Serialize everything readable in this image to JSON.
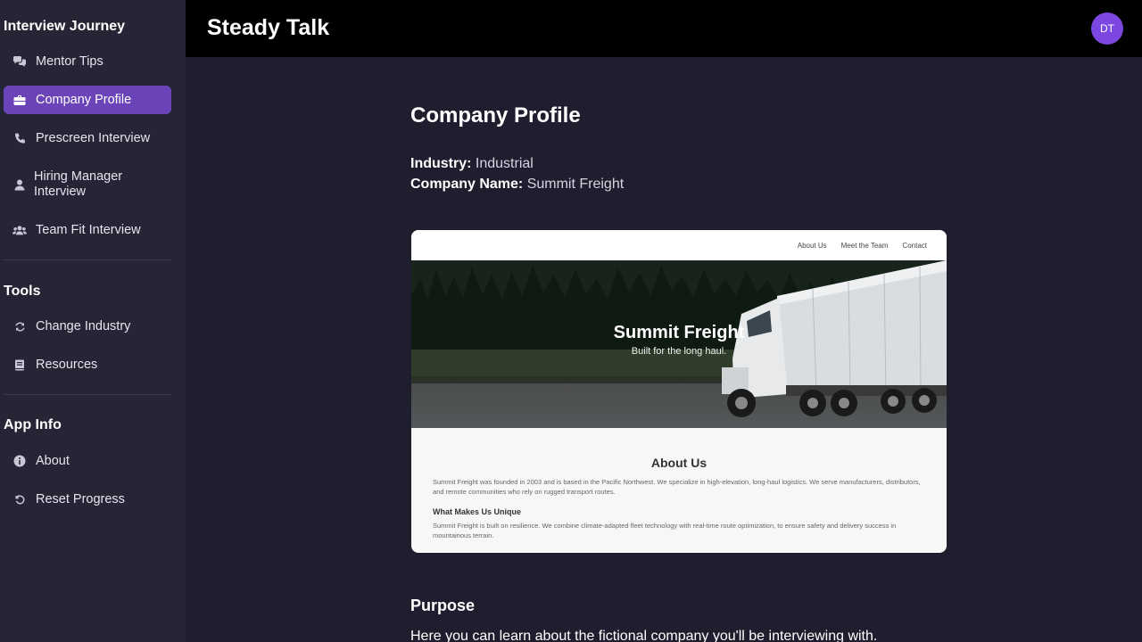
{
  "sidebar": {
    "journey_title": "Interview Journey",
    "journey_items": [
      {
        "label": "Mentor Tips",
        "icon": "comments-icon"
      },
      {
        "label": "Company Profile",
        "icon": "briefcase-icon"
      },
      {
        "label": "Prescreen Interview",
        "icon": "phone-icon"
      },
      {
        "label": "Hiring Manager Interview",
        "icon": "user-icon"
      },
      {
        "label": "Team Fit Interview",
        "icon": "users-icon"
      }
    ],
    "tools_title": "Tools",
    "tools_items": [
      {
        "label": "Change Industry",
        "icon": "sync-icon"
      },
      {
        "label": "Resources",
        "icon": "book-icon"
      }
    ],
    "info_title": "App Info",
    "info_items": [
      {
        "label": "About",
        "icon": "info-icon"
      },
      {
        "label": "Reset Progress",
        "icon": "reset-icon"
      }
    ]
  },
  "header": {
    "brand": "Steady Talk",
    "avatar_initials": "DT"
  },
  "main": {
    "title": "Company Profile",
    "industry_label": "Industry:",
    "industry_value": "Industrial",
    "company_label": "Company Name:",
    "company_value": "Summit Freight",
    "purpose_title": "Purpose",
    "purpose_text": "Here you can learn about the fictional company you'll be interviewing with."
  },
  "preview": {
    "nav": [
      "About Us",
      "Meet the Team",
      "Contact"
    ],
    "hero_title": "Summit Freight",
    "hero_subtitle": "Built for the long haul.",
    "about_title": "About Us",
    "about_text": "Summit Freight was founded in 2003 and is based in the Pacific Northwest. We specialize in high-elevation, long-haul logistics. We serve manufacturers, distributors, and remote communities who rely on rugged transport routes.",
    "unique_title": "What Makes Us Unique",
    "unique_text": "Summit Freight is built on resilience. We combine climate-adapted fleet technology with real-time route optimization, to ensure safety and delivery success in mountainous terrain."
  },
  "colors": {
    "accent": "#6a44b8",
    "avatar": "#7b47e0",
    "sidebar_bg": "#262536",
    "main_bg": "#1f1e2e",
    "topbar_bg": "#000000"
  }
}
